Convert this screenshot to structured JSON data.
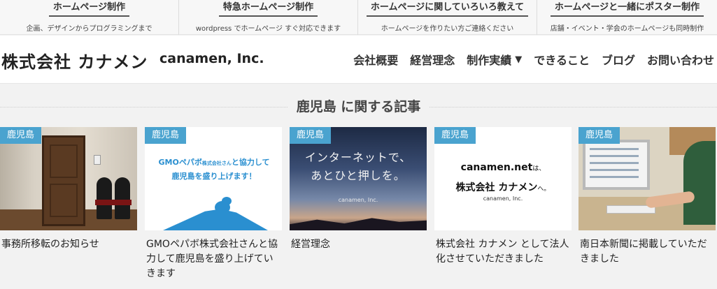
{
  "topbar": {
    "items": [
      {
        "title": "ホームページ制作",
        "sub": "企画、デザインからプログラミングまで"
      },
      {
        "title": "特急ホームページ制作",
        "sub": "wordpress でホームページ すぐ対応できます"
      },
      {
        "title": "ホームページに関していろいろ教えて",
        "sub": "ホームページを作りたい方ご連絡ください"
      },
      {
        "title": "ホームページと一緒にポスター制作",
        "sub": "店舗・イベント・学会のホームページも同時制作"
      }
    ]
  },
  "header": {
    "logo": "株式会社 カナメン",
    "logo_en": "canamen, Inc.",
    "nav": [
      {
        "label": "会社概要"
      },
      {
        "label": "経営理念"
      },
      {
        "label": "制作実績",
        "caret": "▼"
      },
      {
        "label": "できること"
      },
      {
        "label": "ブログ"
      },
      {
        "label": "お問い合わせ"
      }
    ]
  },
  "section": {
    "title": "鹿児島 に関する記事"
  },
  "cards": [
    {
      "tag": "鹿児島",
      "title": "事務所移転のお知らせ"
    },
    {
      "tag": "鹿児島",
      "title": "GMOペパボ株式会社さんと協力して鹿児島を盛り上げていきます",
      "banner_line1": "GMOペパボ",
      "banner_line1_small": "株式会社さん",
      "banner_line1_tail": "と協力して",
      "banner_line2": "鹿児島を盛り上げます！"
    },
    {
      "tag": "鹿児島",
      "title": "経営理念",
      "copy_line1": "インターネットで、",
      "copy_line2": "あとひと押しを。",
      "brand": "canamen, Inc."
    },
    {
      "tag": "鹿児島",
      "title": "株式会社 カナメン として法人化させていただきました",
      "l1": "canamen.net",
      "l1_small": "は、",
      "l2": "株式会社 カナメン",
      "l2_small": "へ。",
      "l3": "canamen, Inc."
    },
    {
      "tag": "鹿児島",
      "title": "南日本新聞に掲載していただきました"
    }
  ],
  "colors": {
    "tag_bg": "#4aa3cf",
    "accent_blue": "#2a8fd0"
  }
}
